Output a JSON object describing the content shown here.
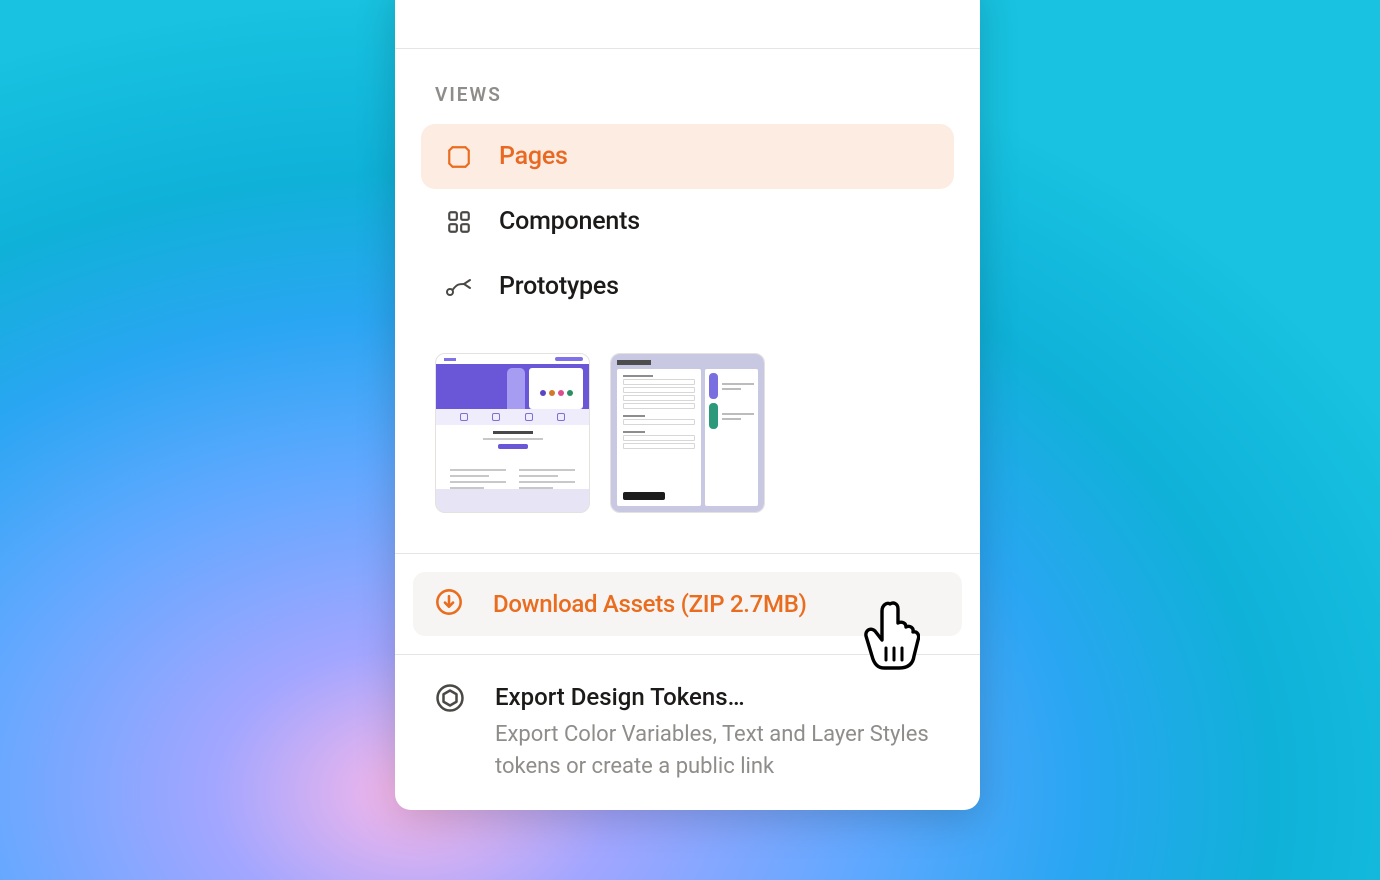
{
  "section_title": "VIEWS",
  "views": {
    "pages": {
      "label": "Pages"
    },
    "components": {
      "label": "Components"
    },
    "prototypes": {
      "label": "Prototypes"
    }
  },
  "download": {
    "label": "Download Assets (ZIP 2.7MB)"
  },
  "tokens": {
    "title": "Export Design Tokens…",
    "description": "Export Color Variables, Text and Layer Styles tokens or create a public link"
  },
  "colors": {
    "accent": "#ea6c1f",
    "accent_bg": "#fdece2"
  }
}
